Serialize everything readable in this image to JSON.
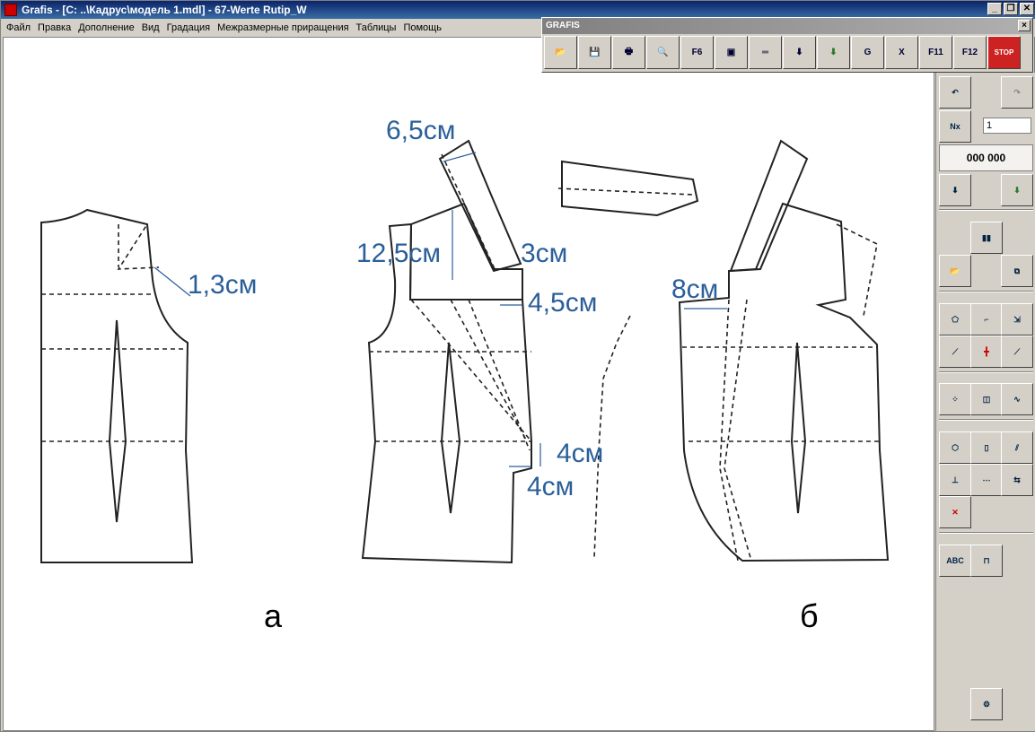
{
  "window": {
    "title": "Grafis - [C: ..\\Кадрус\\модель 1.mdl] - 67-Werte Rutip_W",
    "minimize": "_",
    "restore": "❐",
    "close": "✕"
  },
  "menu": [
    "Файл",
    "Правка",
    "Дополнение",
    "Вид",
    "Градация",
    "Межразмерные приращения",
    "Таблицы",
    "Помощь"
  ],
  "toolbar": {
    "title": "GRAFIS",
    "close": "×",
    "buttons": [
      {
        "name": "open-icon",
        "glyph": "📂"
      },
      {
        "name": "save-icon",
        "glyph": "💾"
      },
      {
        "name": "print-icon",
        "glyph": "🖶"
      },
      {
        "name": "zoom-icon",
        "glyph": "🔍"
      },
      {
        "name": "f6-icon",
        "glyph": "F6"
      },
      {
        "name": "layers-icon",
        "glyph": "▣"
      },
      {
        "name": "tape-measure-icon",
        "glyph": "═"
      },
      {
        "name": "download-icon",
        "glyph": "⬇"
      },
      {
        "name": "download-green-icon",
        "glyph": "⬇"
      },
      {
        "name": "grade-icon",
        "glyph": "G"
      },
      {
        "name": "excel-icon",
        "glyph": "X"
      },
      {
        "name": "f11-icon",
        "glyph": "F11"
      },
      {
        "name": "f12-icon",
        "glyph": "F12"
      },
      {
        "name": "stop-icon",
        "glyph": "STOP"
      }
    ]
  },
  "panel": {
    "nx_value": "1",
    "counter": "000 000",
    "nx_label": "Nx"
  },
  "drawing": {
    "labels": {
      "m1": "1,3см",
      "m2": "6,5см",
      "m3": "12,5см",
      "m4": "3см",
      "m5": "4,5см",
      "m6": "4см",
      "m7": "4см",
      "m8": "8см",
      "fig_a": "а",
      "fig_b": "б"
    },
    "label_color": "#2b5f9a"
  }
}
